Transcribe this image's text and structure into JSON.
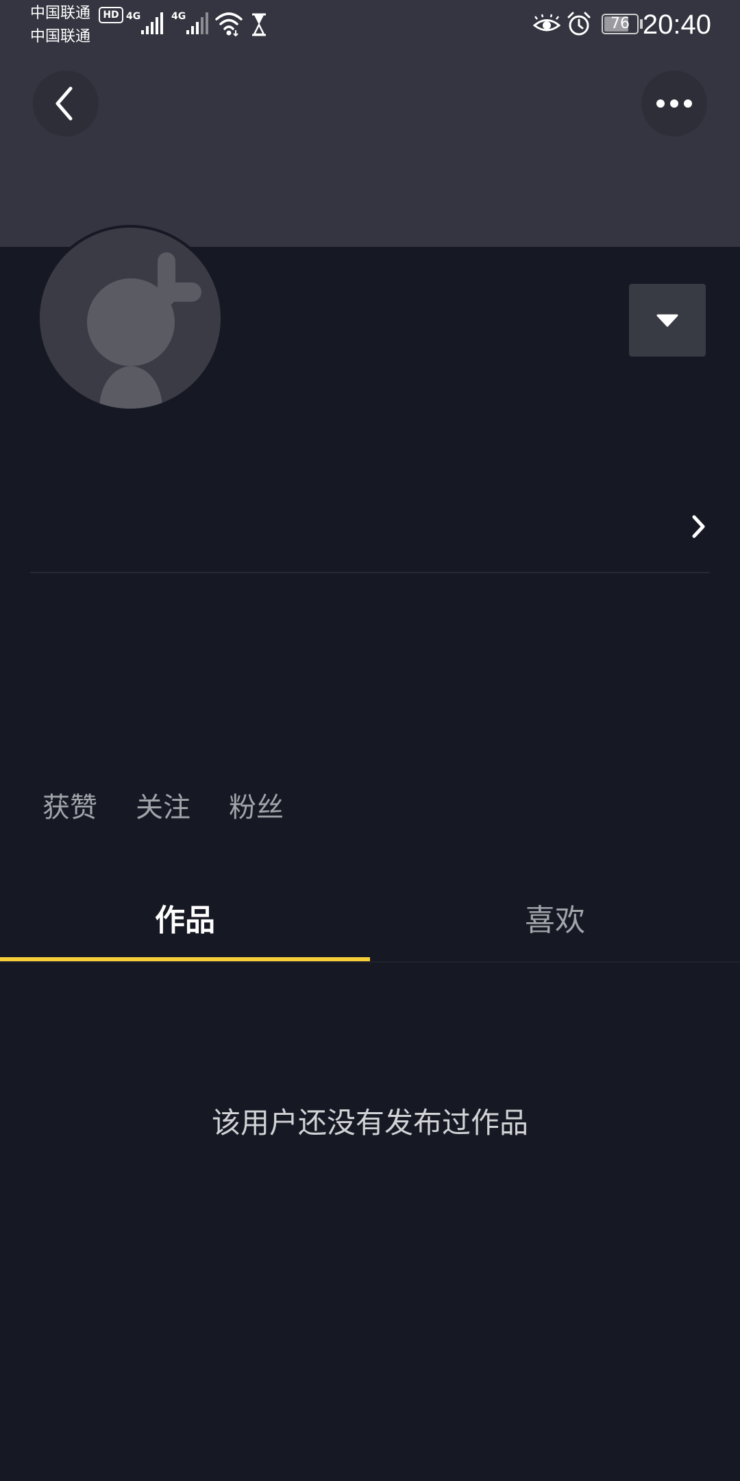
{
  "status_bar": {
    "carrier_1": "中国联通",
    "carrier_2": "中国联通",
    "hd_badge": "HD",
    "network_1": "4G",
    "network_2": "4G",
    "battery_level": "76",
    "battery_fraction": 0.76,
    "time": "20:40",
    "icons": [
      "signal-icon",
      "wifi-icon",
      "hourglass-icon",
      "eye-icon",
      "alarm-icon",
      "battery-icon"
    ]
  },
  "header": {
    "back_icon": "chevron-left-icon",
    "more_icon": "more-horizontal-icon"
  },
  "profile": {
    "avatar_icon": "default-avatar-icon",
    "dropdown_icon": "triangle-down-icon",
    "detail_icon": "chevron-right-icon"
  },
  "stats": {
    "likes_label": "获赞",
    "following_label": "关注",
    "followers_label": "粉丝"
  },
  "tabs": [
    {
      "label": "作品",
      "active": true
    },
    {
      "label": "喜欢",
      "active": false
    }
  ],
  "empty_state": {
    "message": "该用户还没有发布过作品"
  },
  "colors": {
    "background": "#161823",
    "header_bg": "#353541",
    "accent": "#f6cf38",
    "muted_text": "#a2a4aa"
  }
}
